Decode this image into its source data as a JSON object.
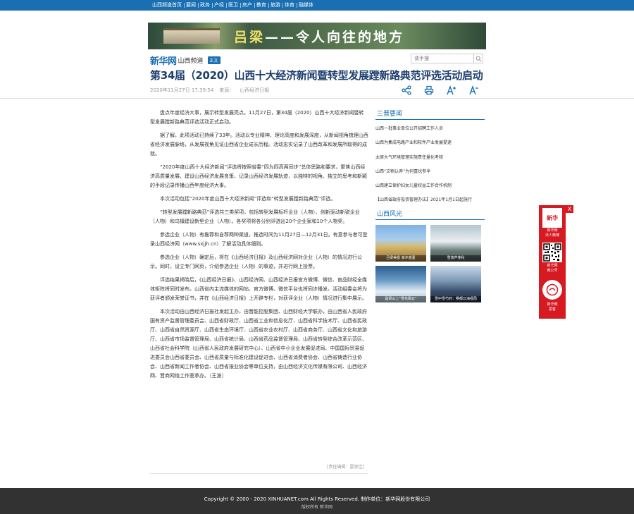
{
  "topnav": {
    "items": [
      "山西频道首页",
      "要闻",
      "政务",
      "产经",
      "医卫",
      "房产",
      "教育",
      "旅游",
      "体育",
      "融媒体"
    ]
  },
  "banner": {
    "title_accent": "吕梁",
    "title_rest": "——令人向往的地方"
  },
  "brand": {
    "logo": "新华网",
    "channel": "山西频道",
    "tag": "正文"
  },
  "search": {
    "placeholder": "请手搜"
  },
  "article": {
    "title": "第34届（2020）山西十大经济新闻暨转型发展蹚新路典范评选活动启动",
    "date": "2020年11月27日 17:39:54",
    "source_label": "来源：",
    "source": "山西经济日报",
    "paragraphs": [
      "盘点年度经济大事，展示转型发展亮点。11月27日，第34届（2020）山西十大经济新闻暨转型发展蹚新路典范评选活动正式启动。",
      "据了解，此项活动已持续了33年。活动以专业精神、理论高度和发展深度，从新闻视角梳理山西省经济发展脉络，从发展视角见证山西省企业成长历程。活动忠实记录了山西改革和发展所取得的成就。",
      "“2020年度山西十大经济新闻”评选将按照省委“四为四高两同步”总体思路和要求，聚焦山西经济高质量发展、建设山西经济发展良策、记录山西经济发展轨迹，以独特的视角、独立的思考和新颖的手段记录传播山西年度经济大事。",
      "本次活动包括“2020年度山西十大经济新闻”评选和“转型发展蹚新路典范”评选。",
      "“转型发展蹚新路典范”评选共三类奖项，包括转型发展标杆企业（人物）、创新驱动新锐企业（人物）和乌镇建设新型企业（人物）。各奖项将各分别评选出20个企业家和10个人物奖。",
      "参选企业（人物）有推荐和自荐两种渠道，推选时间为11月27日—12月31日。有意参与者可登录山西经济网（www.sxjjh.cn）了解活动具体细则。",
      "参选企业（人物）确定后，将在《山西经济日报》及山西经济网对企业（人物）的情况进行公示。同时，设立专门网页，介绍参选企业（人物）的事迹，并进行网上投票。",
      "评选结果揭晓后，《山西经济日报》、山西经济网、山西经济日报官方微博、微信、官品财经全媒体矩阵将同时发布。山西省内主流媒体的网站、官方微博、微信平台也将同步播发。活动组委会将为获评者颁发荣誉证书，并在《山西经济日报》上开辟专栏，对获评企业（人物）情况进行集中展示。",
      "本次活动由山西经济日报社发起主办，由晋能控股集团、山西财经大学联办，由山西省人民政府国有资产监督管理委员会、山西省财政厅、山西省工业和信息化厅、山西省科学技术厅、山西省民政厅、山西省自然资源厅、山西省生态环境厅、山西省农业农村厅、山西省商务厅、山西省文化和旅游厅、山西省市场监督管理局、山西省统计局、山西省药品监督管理局、山西省转型综合改革示范区、山西省社会科学院（山西省人民政府发展研究中心）、山西省中小企业发展促进局、中国国际贸易促进委员会山西省委员会、山西省质量与标准化建设促进会、山西省消费者协会、山西省铸造行业协会、山西省新闻工作者协会、山西省报业协会等单位支持，由山西经济文化传媒有限公司、山西经济网、晋商网络工作室承办。（王波）"
    ],
    "editor": "[责任编辑：雷思佳]"
  },
  "sidebar": {
    "news_heading": "三晋要闻",
    "news": [
      "山西一批事业单位公开招聘工作人员",
      "山西为集成电路产业和软件产业发展提速",
      "太原大气环境管理实施责任量化考核",
      "山西“文物认养”为何喜忧参半",
      "山西建立保护妇女儿童权益工作合作机制",
      "【山西省政府投资管理办法】2021年1月1日起施行"
    ],
    "photos_heading": "山西风光",
    "photos": [
      "吕梁美景 家乡盛夏",
      "雪落芦芽秋",
      "昌梁山上“雪花飘云”",
      "雪中雪芍药：雾都云海视局"
    ]
  },
  "float_panel": {
    "close": "X",
    "logo_text": "新华",
    "label1": "新华网\n法人微博",
    "label2": "新华网\n微公号",
    "label3": "新华网\n思客"
  },
  "footer": {
    "copyright": "Copyright © 2000 - 2020 XINHUANET.com   All Rights Reserved.    制作单位：新华网股份有限公司",
    "rights": "版权所有  新华网"
  },
  "colors": {
    "brand_blue": "#1a6eb2",
    "headline": "#1d3e6e",
    "float_red": "#d71921",
    "footer_bg": "#323232"
  }
}
